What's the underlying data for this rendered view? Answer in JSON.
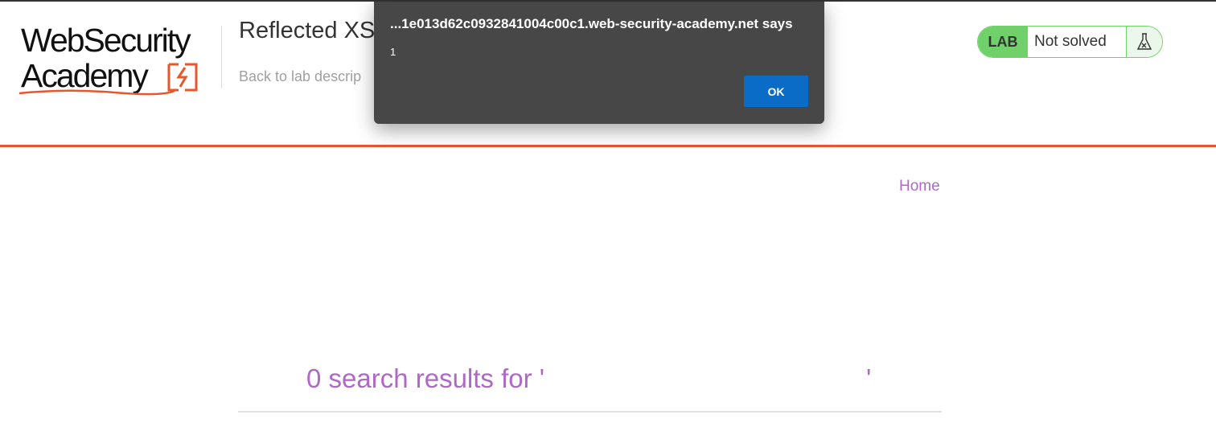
{
  "header": {
    "logo_line1": "WebSecurity",
    "logo_line2": "Academy",
    "lab_title": "Reflected XS",
    "back_link": "Back to lab descrip",
    "lab_badge": "LAB",
    "lab_status": "Not solved"
  },
  "nav": {
    "home": "Home"
  },
  "search": {
    "results_prefix": "0 search results for '",
    "results_suffix": "'"
  },
  "dialog": {
    "title": "...1e013d62c0932841004c00c1.web-security-academy.net says",
    "message": "1",
    "ok_label": "OK"
  },
  "colors": {
    "accent_orange": "#e5582d",
    "lab_green": "#70d16a",
    "link_purple": "#ae69c4",
    "dialog_bg": "#474747",
    "dialog_button": "#0a6cc6"
  },
  "icons": {
    "logo_mark": "lightning-bracket-icon",
    "lab_status_icon": "flask-icon"
  }
}
